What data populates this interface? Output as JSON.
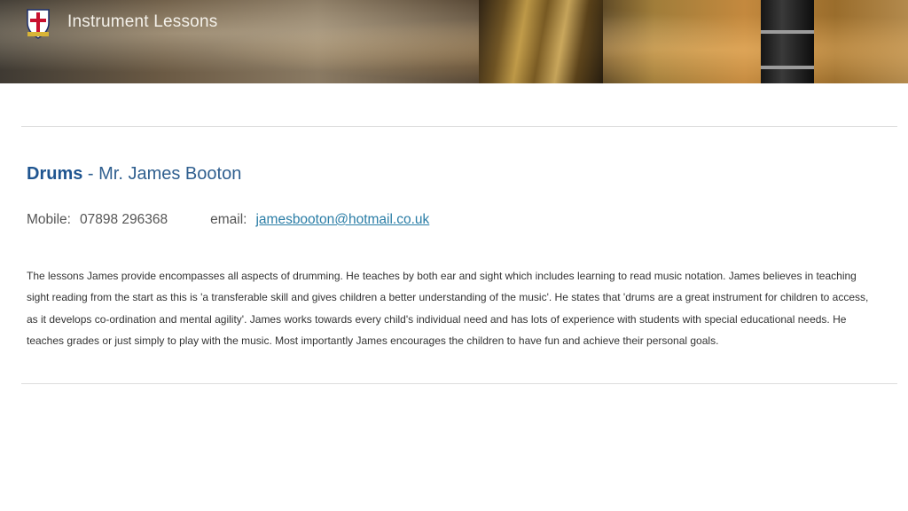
{
  "header": {
    "title": "Instrument Lessons",
    "crest_icon": "school-crest-icon"
  },
  "teacher": {
    "subject": "Drums",
    "separator": " - ",
    "name": "Mr. James Booton",
    "mobile_label": "Mobile:",
    "mobile": "07898 296368",
    "email_label": "email:",
    "email": "jamesbooton@hotmail.co.uk",
    "bio": "The lessons James provide encompasses all aspects of drumming. He teaches by both ear and sight which includes learning to read music notation. James believes in teaching sight reading from the start as this is 'a transferable skill and gives children a better understanding of the music'.   He states that 'drums are a great instrument for children to access, as it develops co-ordination and mental agility'. James works towards every child's individual need and has lots of experience with students with special educational needs. He teaches grades or just simply to play with the music. Most importantly James encourages the children to have fun and achieve their personal goals."
  },
  "colors": {
    "heading": "#2f5f8f",
    "link": "#2a7da6"
  }
}
